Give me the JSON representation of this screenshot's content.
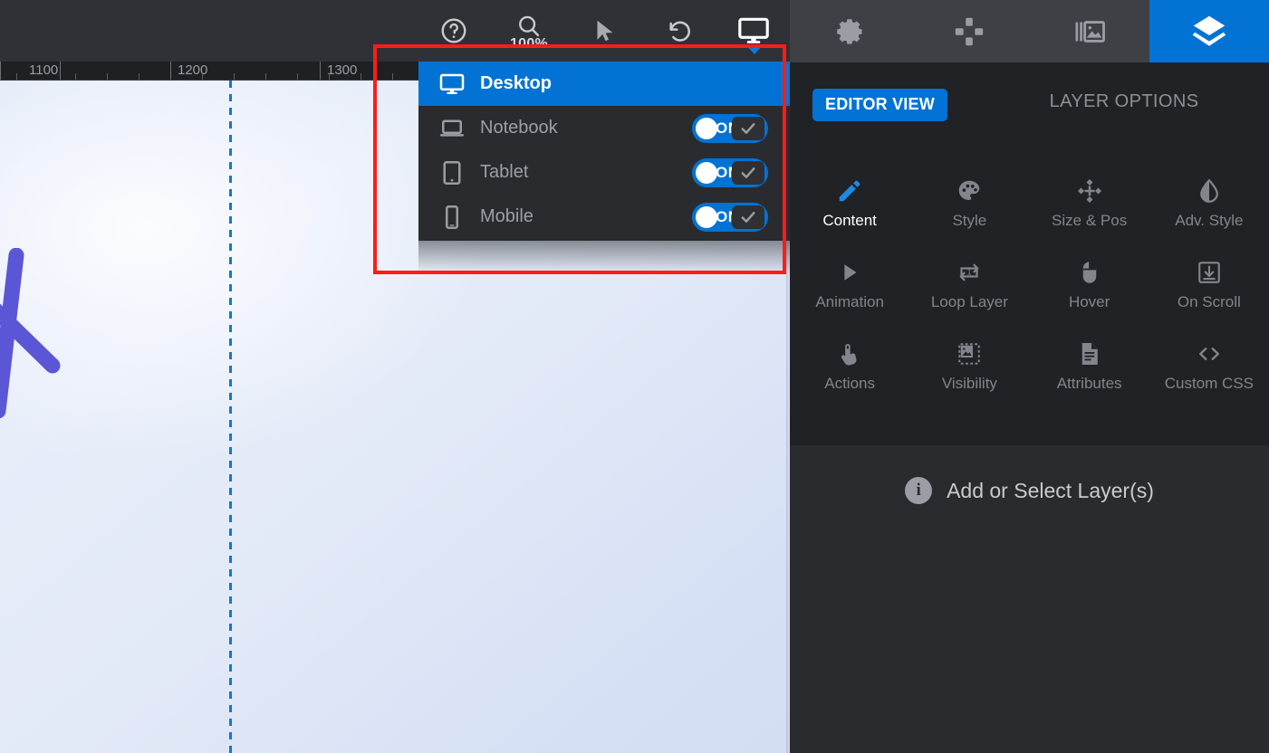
{
  "toolbar": {
    "buttons": [
      {
        "name": "help-icon",
        "label": ""
      },
      {
        "name": "zoom-icon",
        "label": "100%"
      },
      {
        "name": "cursor-icon",
        "label": ""
      },
      {
        "name": "undo-icon",
        "label": ""
      },
      {
        "name": "desktop-preview-icon",
        "label": ""
      }
    ],
    "zoom_level": "100%"
  },
  "ruler": {
    "labels": [
      "1100",
      "1200",
      "1300"
    ],
    "positions": [
      36,
      212,
      377
    ]
  },
  "device_dropdown": {
    "items": [
      {
        "label": "Desktop",
        "icon": "monitor-icon",
        "active": true,
        "toggle": null
      },
      {
        "label": "Notebook",
        "icon": "laptop-icon",
        "active": false,
        "toggle": "ON"
      },
      {
        "label": "Tablet",
        "icon": "tablet-icon",
        "active": false,
        "toggle": "ON"
      },
      {
        "label": "Mobile",
        "icon": "mobile-icon",
        "active": false,
        "toggle": "ON"
      }
    ]
  },
  "right_panel": {
    "tabs": [
      {
        "name": "settings-tab",
        "icon": "gear-icon",
        "active": false
      },
      {
        "name": "transform-tab",
        "icon": "move-icon",
        "active": false
      },
      {
        "name": "slides-tab",
        "icon": "slides-icon",
        "active": false
      },
      {
        "name": "layers-tab",
        "icon": "layers-icon",
        "active": true
      }
    ],
    "editor_view_label": "EDITOR VIEW",
    "layer_options_label": "LAYER OPTIONS",
    "option_grid": [
      {
        "label": "Content",
        "icon": "pencil-icon",
        "active": true
      },
      {
        "label": "Style",
        "icon": "palette-icon",
        "active": false
      },
      {
        "label": "Size & Pos",
        "icon": "move-icon",
        "active": false
      },
      {
        "label": "Adv. Style",
        "icon": "droplet-icon",
        "active": false
      },
      {
        "label": "Animation",
        "icon": "play-icon",
        "active": false
      },
      {
        "label": "Loop Layer",
        "icon": "loop-icon",
        "active": false
      },
      {
        "label": "Hover",
        "icon": "mouse-icon",
        "active": false
      },
      {
        "label": "On Scroll",
        "icon": "scroll-down-icon",
        "active": false
      },
      {
        "label": "Actions",
        "icon": "tap-hand-icon",
        "active": false
      },
      {
        "label": "Visibility",
        "icon": "image-dashed-icon",
        "active": false
      },
      {
        "label": "Attributes",
        "icon": "document-icon",
        "active": false
      },
      {
        "label": "Custom CSS",
        "icon": "code-icon",
        "active": false
      }
    ],
    "empty_state": {
      "icon": "info-icon",
      "badge_glyph": "i",
      "text": "Add or Select Layer(s)"
    }
  },
  "colors": {
    "accent_blue": "#0273d4",
    "highlight_red": "#fc1d18",
    "panel_dark": "#212226",
    "toolbar_dark": "#303136",
    "guide_blue": "#1277d4",
    "brush_purple": "#5b56d6"
  }
}
